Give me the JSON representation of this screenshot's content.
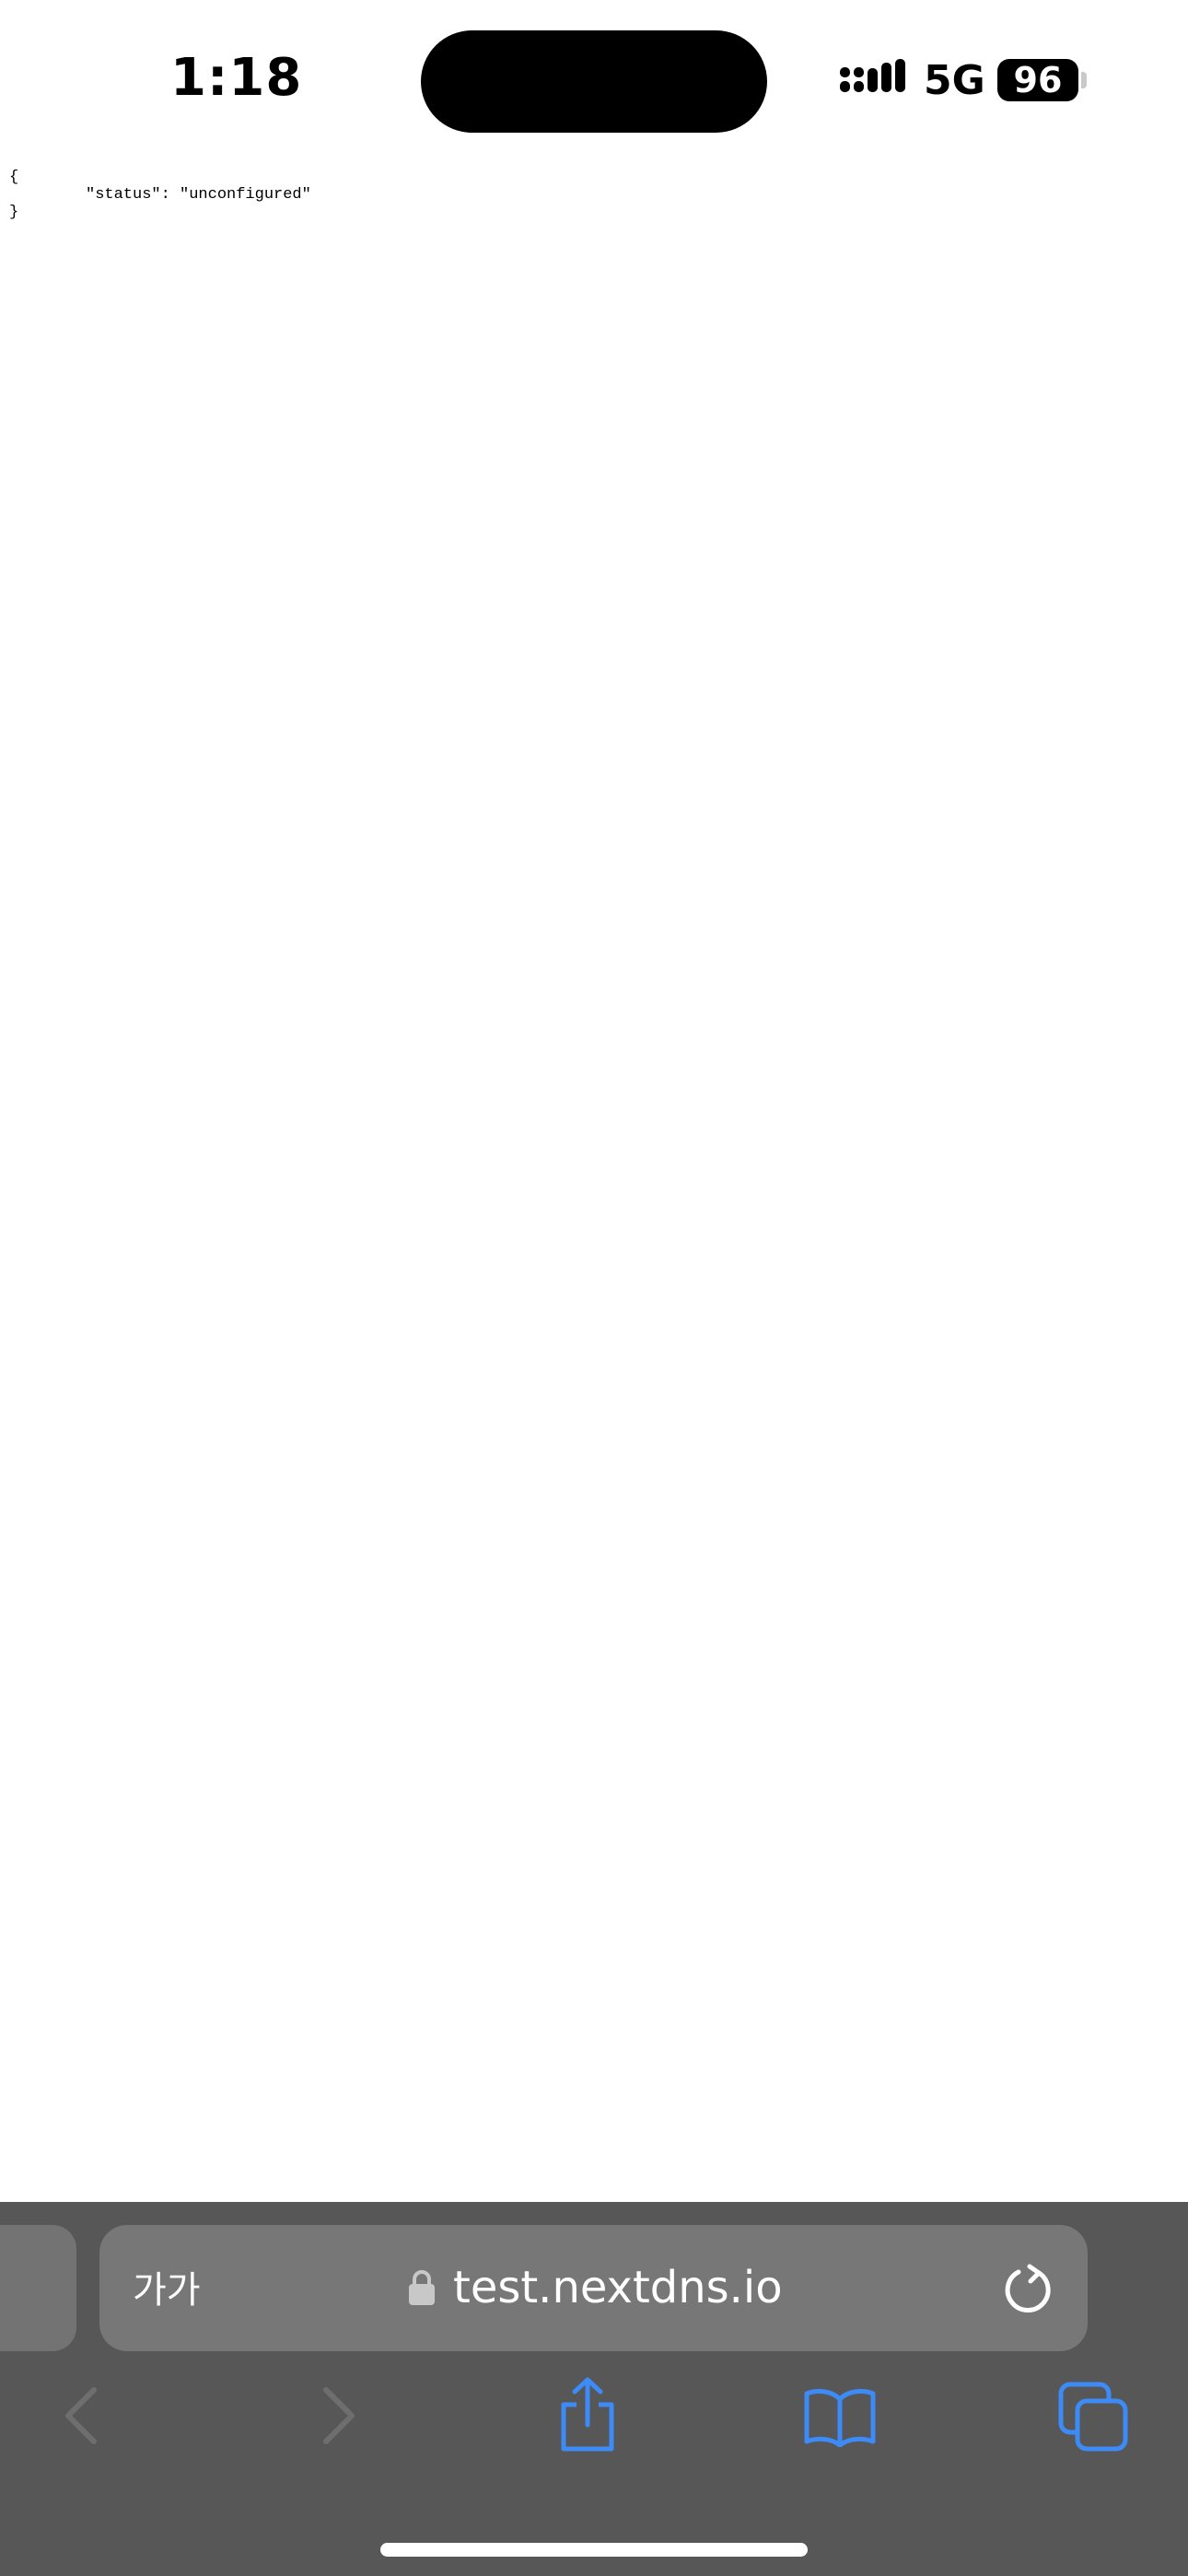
{
  "status_bar": {
    "time": "1:18",
    "network": "5G",
    "battery": "96"
  },
  "page": {
    "json_lines": {
      "open": "{",
      "status_line": "\"status\": \"unconfigured\"",
      "close": "}"
    }
  },
  "toolbar": {
    "text_size_label": "가가",
    "url": "test.nextdns.io",
    "icons": {
      "back": "back-chevron-icon",
      "forward": "forward-chevron-icon",
      "share": "share-icon",
      "bookmarks": "bookmarks-book-icon",
      "tabs": "tabs-icon",
      "reload": "reload-icon",
      "lock": "lock-icon"
    },
    "colors": {
      "background": "#575757",
      "address_bar": "#777777",
      "accent": "#3D8BF7",
      "disabled": "#6E6E6E"
    }
  }
}
